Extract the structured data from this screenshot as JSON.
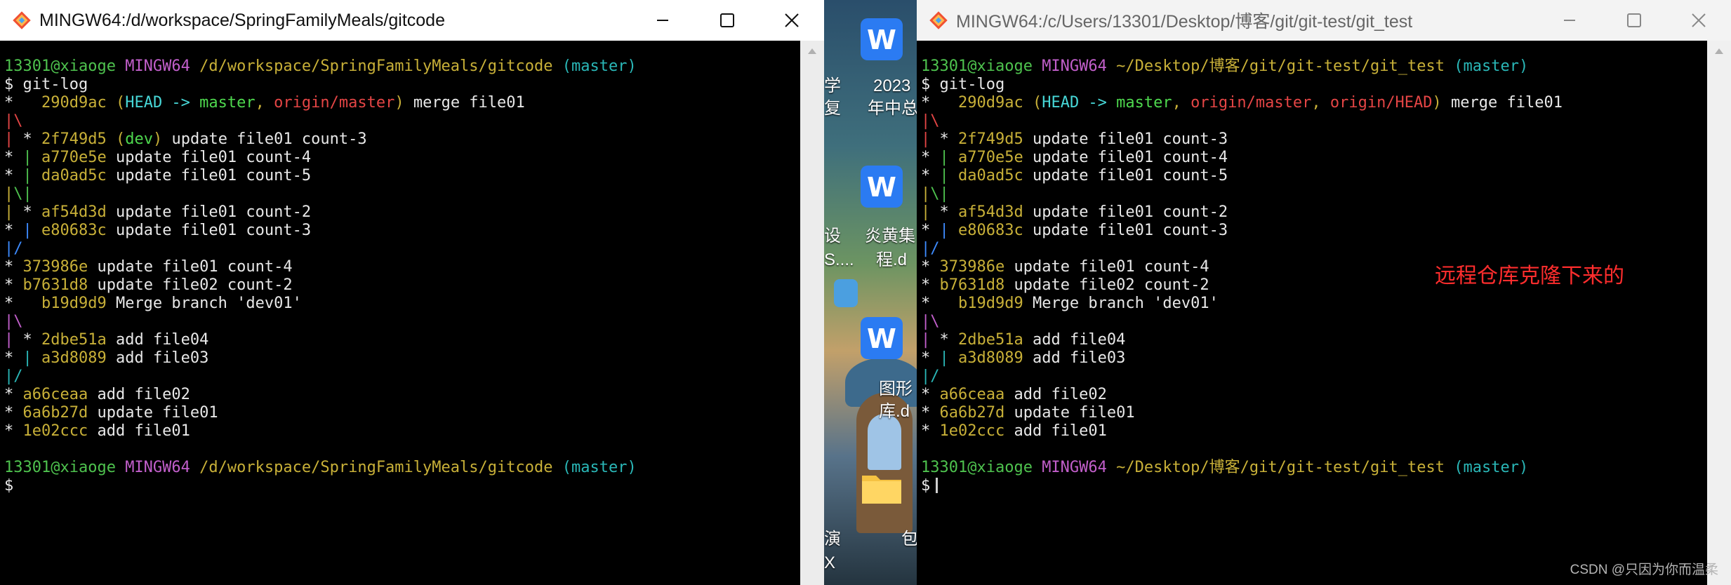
{
  "left_window": {
    "title": "MINGW64:/d/workspace/SpringFamilyMeals/gitcode",
    "lines": [
      [
        {
          "t": "13301@xiaoge ",
          "c": "green"
        },
        {
          "t": "MINGW64 ",
          "c": "magenta"
        },
        {
          "t": "/d/workspace/SpringFamilyMeals/gitcode",
          "c": "yellow"
        },
        {
          "t": " (master)",
          "c": "cyan"
        }
      ],
      [
        {
          "t": "$ git-log",
          "c": "white"
        }
      ],
      [
        {
          "t": "*   ",
          "c": "white"
        },
        {
          "t": "290d9ac",
          "c": "yellow"
        },
        {
          "t": " (",
          "c": "yellow"
        },
        {
          "t": "HEAD -> ",
          "c": "bcyan"
        },
        {
          "t": "master",
          "c": "bgreen"
        },
        {
          "t": ", ",
          "c": "yellow"
        },
        {
          "t": "origin/master",
          "c": "red"
        },
        {
          "t": ")",
          "c": "yellow"
        },
        {
          "t": " merge file01",
          "c": "white"
        }
      ],
      [
        {
          "t": "|\\",
          "c": "red"
        }
      ],
      [
        {
          "t": "| ",
          "c": "red"
        },
        {
          "t": "* ",
          "c": "white"
        },
        {
          "t": "2f749d5",
          "c": "yellow"
        },
        {
          "t": " (",
          "c": "yellow"
        },
        {
          "t": "dev",
          "c": "bgreen"
        },
        {
          "t": ")",
          "c": "yellow"
        },
        {
          "t": " update file01 count-3",
          "c": "white"
        }
      ],
      [
        {
          "t": "* ",
          "c": "white"
        },
        {
          "t": "| ",
          "c": "green"
        },
        {
          "t": "a770e5e",
          "c": "yellow"
        },
        {
          "t": " update file01 count-4",
          "c": "white"
        }
      ],
      [
        {
          "t": "* ",
          "c": "white"
        },
        {
          "t": "| ",
          "c": "green"
        },
        {
          "t": "da0ad5c",
          "c": "yellow"
        },
        {
          "t": " update file01 count-5",
          "c": "white"
        }
      ],
      [
        {
          "t": "|",
          "c": "yellow"
        },
        {
          "t": "\\",
          "c": "green"
        },
        {
          "t": "|",
          "c": "green"
        }
      ],
      [
        {
          "t": "| ",
          "c": "yellow"
        },
        {
          "t": "* ",
          "c": "white"
        },
        {
          "t": "af54d3d",
          "c": "yellow"
        },
        {
          "t": " update file01 count-2",
          "c": "white"
        }
      ],
      [
        {
          "t": "* ",
          "c": "white"
        },
        {
          "t": "| ",
          "c": "bblue"
        },
        {
          "t": "e80683c",
          "c": "yellow"
        },
        {
          "t": " update file01 count-3",
          "c": "white"
        }
      ],
      [
        {
          "t": "|/",
          "c": "bblue"
        }
      ],
      [
        {
          "t": "* ",
          "c": "white"
        },
        {
          "t": "373986e",
          "c": "yellow"
        },
        {
          "t": " update file01 count-4",
          "c": "white"
        }
      ],
      [
        {
          "t": "* ",
          "c": "white"
        },
        {
          "t": "b7631d8",
          "c": "yellow"
        },
        {
          "t": " update file02 count-2",
          "c": "white"
        }
      ],
      [
        {
          "t": "*   ",
          "c": "white"
        },
        {
          "t": "b19d9d9",
          "c": "yellow"
        },
        {
          "t": " Merge branch 'dev01'",
          "c": "white"
        }
      ],
      [
        {
          "t": "|\\",
          "c": "magenta"
        }
      ],
      [
        {
          "t": "| ",
          "c": "magenta"
        },
        {
          "t": "* ",
          "c": "white"
        },
        {
          "t": "2dbe51a",
          "c": "yellow"
        },
        {
          "t": " add file04",
          "c": "white"
        }
      ],
      [
        {
          "t": "* ",
          "c": "white"
        },
        {
          "t": "| ",
          "c": "cyan"
        },
        {
          "t": "a3d8089",
          "c": "yellow"
        },
        {
          "t": " add file03",
          "c": "white"
        }
      ],
      [
        {
          "t": "|/",
          "c": "cyan"
        }
      ],
      [
        {
          "t": "* ",
          "c": "white"
        },
        {
          "t": "a66ceaa",
          "c": "yellow"
        },
        {
          "t": " add file02",
          "c": "white"
        }
      ],
      [
        {
          "t": "* ",
          "c": "white"
        },
        {
          "t": "6a6b27d",
          "c": "yellow"
        },
        {
          "t": " update file01",
          "c": "white"
        }
      ],
      [
        {
          "t": "* ",
          "c": "white"
        },
        {
          "t": "1e02ccc",
          "c": "yellow"
        },
        {
          "t": " add file01",
          "c": "white"
        }
      ],
      [
        {
          "t": "",
          "c": "white"
        }
      ],
      [
        {
          "t": "13301@xiaoge ",
          "c": "green"
        },
        {
          "t": "MINGW64 ",
          "c": "magenta"
        },
        {
          "t": "/d/workspace/SpringFamilyMeals/gitcode",
          "c": "yellow"
        },
        {
          "t": " (master)",
          "c": "cyan"
        }
      ],
      [
        {
          "t": "$",
          "c": "white"
        }
      ]
    ]
  },
  "right_window": {
    "title": "MINGW64:/c/Users/13301/Desktop/博客/git/git-test/git_test",
    "lines": [
      [
        {
          "t": "13301@xiaoge ",
          "c": "green"
        },
        {
          "t": "MINGW64 ",
          "c": "magenta"
        },
        {
          "t": "~/Desktop/博客/git/git-test/git_test",
          "c": "yellow"
        },
        {
          "t": " (master)",
          "c": "cyan"
        }
      ],
      [
        {
          "t": "$ git-log",
          "c": "white"
        }
      ],
      [
        {
          "t": "*   ",
          "c": "white"
        },
        {
          "t": "290d9ac",
          "c": "yellow"
        },
        {
          "t": " (",
          "c": "yellow"
        },
        {
          "t": "HEAD -> ",
          "c": "bcyan"
        },
        {
          "t": "master",
          "c": "bgreen"
        },
        {
          "t": ", ",
          "c": "yellow"
        },
        {
          "t": "origin/master",
          "c": "red"
        },
        {
          "t": ", ",
          "c": "yellow"
        },
        {
          "t": "origin/HEAD",
          "c": "red"
        },
        {
          "t": ")",
          "c": "yellow"
        },
        {
          "t": " merge file01",
          "c": "white"
        }
      ],
      [
        {
          "t": "|\\",
          "c": "red"
        }
      ],
      [
        {
          "t": "| ",
          "c": "red"
        },
        {
          "t": "* ",
          "c": "white"
        },
        {
          "t": "2f749d5",
          "c": "yellow"
        },
        {
          "t": " update file01 count-3",
          "c": "white"
        }
      ],
      [
        {
          "t": "* ",
          "c": "white"
        },
        {
          "t": "| ",
          "c": "green"
        },
        {
          "t": "a770e5e",
          "c": "yellow"
        },
        {
          "t": " update file01 count-4",
          "c": "white"
        }
      ],
      [
        {
          "t": "* ",
          "c": "white"
        },
        {
          "t": "| ",
          "c": "green"
        },
        {
          "t": "da0ad5c",
          "c": "yellow"
        },
        {
          "t": " update file01 count-5",
          "c": "white"
        }
      ],
      [
        {
          "t": "|",
          "c": "yellow"
        },
        {
          "t": "\\",
          "c": "green"
        },
        {
          "t": "|",
          "c": "green"
        }
      ],
      [
        {
          "t": "| ",
          "c": "yellow"
        },
        {
          "t": "* ",
          "c": "white"
        },
        {
          "t": "af54d3d",
          "c": "yellow"
        },
        {
          "t": " update file01 count-2",
          "c": "white"
        }
      ],
      [
        {
          "t": "* ",
          "c": "white"
        },
        {
          "t": "| ",
          "c": "bblue"
        },
        {
          "t": "e80683c",
          "c": "yellow"
        },
        {
          "t": " update file01 count-3",
          "c": "white"
        }
      ],
      [
        {
          "t": "|/",
          "c": "bblue"
        }
      ],
      [
        {
          "t": "* ",
          "c": "white"
        },
        {
          "t": "373986e",
          "c": "yellow"
        },
        {
          "t": " update file01 count-4",
          "c": "white"
        }
      ],
      [
        {
          "t": "* ",
          "c": "white"
        },
        {
          "t": "b7631d8",
          "c": "yellow"
        },
        {
          "t": " update file02 count-2",
          "c": "white"
        }
      ],
      [
        {
          "t": "*   ",
          "c": "white"
        },
        {
          "t": "b19d9d9",
          "c": "yellow"
        },
        {
          "t": " Merge branch 'dev01'",
          "c": "white"
        }
      ],
      [
        {
          "t": "|\\",
          "c": "magenta"
        }
      ],
      [
        {
          "t": "| ",
          "c": "magenta"
        },
        {
          "t": "* ",
          "c": "white"
        },
        {
          "t": "2dbe51a",
          "c": "yellow"
        },
        {
          "t": " add file04",
          "c": "white"
        }
      ],
      [
        {
          "t": "* ",
          "c": "white"
        },
        {
          "t": "| ",
          "c": "cyan"
        },
        {
          "t": "a3d8089",
          "c": "yellow"
        },
        {
          "t": " add file03",
          "c": "white"
        }
      ],
      [
        {
          "t": "|/",
          "c": "cyan"
        }
      ],
      [
        {
          "t": "* ",
          "c": "white"
        },
        {
          "t": "a66ceaa",
          "c": "yellow"
        },
        {
          "t": " add file02",
          "c": "white"
        }
      ],
      [
        {
          "t": "* ",
          "c": "white"
        },
        {
          "t": "6a6b27d",
          "c": "yellow"
        },
        {
          "t": " update file01",
          "c": "white"
        }
      ],
      [
        {
          "t": "* ",
          "c": "white"
        },
        {
          "t": "1e02ccc",
          "c": "yellow"
        },
        {
          "t": " add file01",
          "c": "white"
        }
      ],
      [
        {
          "t": "",
          "c": "white"
        }
      ],
      [
        {
          "t": "13301@xiaoge ",
          "c": "green"
        },
        {
          "t": "MINGW64 ",
          "c": "magenta"
        },
        {
          "t": "~/Desktop/博客/git/git-test/git_test",
          "c": "yellow"
        },
        {
          "t": " (master)",
          "c": "cyan"
        }
      ],
      [
        {
          "t": "$",
          "c": "white"
        }
      ]
    ],
    "annotation": "远程仓库克隆下来的"
  },
  "desktop": {
    "labels": [
      "学",
      "复",
      "2023",
      "年中总",
      "设",
      "S....",
      "炎黄集",
      "程.d",
      "图形",
      "库.d",
      "演",
      "X",
      "包"
    ]
  },
  "watermark": "CSDN @只因为你而温柔",
  "colors": {
    "green": "#4ec24e",
    "magenta": "#c25fcb",
    "yellow": "#c8b038",
    "cyan": "#2ab7b7",
    "bcyan": "#47d7d7",
    "bgreen": "#4ed84e",
    "red": "#e44545",
    "bblue": "#3d8bff",
    "white": "#e8e8e8",
    "annotation": "#ff2d2d"
  },
  "icons": {
    "app": "git-bash-icon",
    "minimize": "minimize-icon",
    "maximize": "maximize-icon",
    "close": "close-icon",
    "wps_doc": "wps-writer-icon",
    "folder": "folder-icon"
  }
}
